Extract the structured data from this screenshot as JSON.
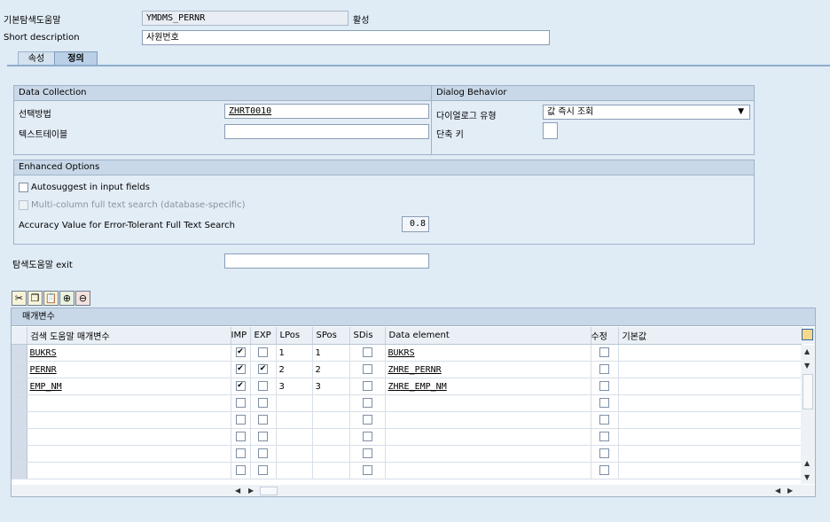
{
  "header": {
    "name_label": "기본탐색도움말",
    "name_value": "YMDMS_PERNR",
    "status": "활성",
    "short_desc_label": "Short description",
    "short_desc_value": "사원번호"
  },
  "tabs": [
    {
      "label": "속성",
      "active": false
    },
    {
      "label": "정의",
      "active": true
    }
  ],
  "data_collection": {
    "title": "Data Collection",
    "method_label": "선택방법",
    "method_value": "ZHRT0010",
    "text_table_label": "텍스트테이블",
    "text_table_value": ""
  },
  "dialog_behavior": {
    "title": "Dialog Behavior",
    "type_label": "다이얼로그 유형",
    "type_value": "값 즉시 조회",
    "hotkey_label": "단축 키",
    "hotkey_value": ""
  },
  "enhanced_options": {
    "title": "Enhanced Options",
    "autosuggest_label": "Autosuggest in input fields",
    "multicolumn_label": "Multi-column full text search (database-specific)",
    "accuracy_label": "Accuracy Value for Error-Tolerant Full Text Search",
    "accuracy_value": "0.8"
  },
  "exit": {
    "label": "탐색도움말 exit",
    "value": ""
  },
  "toolbar": {
    "icons": [
      "cut-icon",
      "copy-icon",
      "paste-icon",
      "insert-row-icon",
      "delete-row-icon"
    ]
  },
  "params": {
    "title": "매개변수",
    "columns": [
      "검색 도움말 매개변수",
      "IMP",
      "EXP",
      "LPos",
      "SPos",
      "SDis",
      "Data element",
      "수정",
      "기본값"
    ],
    "rows": [
      {
        "param": "BUKRS",
        "imp": true,
        "exp": false,
        "lpos": "1",
        "spos": "1",
        "sdis": false,
        "elem": "BUKRS",
        "mod": false,
        "def": ""
      },
      {
        "param": "PERNR",
        "imp": true,
        "exp": true,
        "lpos": "2",
        "spos": "2",
        "sdis": false,
        "elem": "ZHRE_PERNR",
        "mod": false,
        "def": ""
      },
      {
        "param": "EMP_NM",
        "imp": true,
        "exp": false,
        "lpos": "3",
        "spos": "3",
        "sdis": false,
        "elem": "ZHRE_EMP_NM",
        "mod": false,
        "def": ""
      },
      {
        "param": "",
        "imp": false,
        "exp": false,
        "lpos": "",
        "spos": "",
        "sdis": false,
        "elem": "",
        "mod": false,
        "def": ""
      },
      {
        "param": "",
        "imp": false,
        "exp": false,
        "lpos": "",
        "spos": "",
        "sdis": false,
        "elem": "",
        "mod": false,
        "def": ""
      },
      {
        "param": "",
        "imp": false,
        "exp": false,
        "lpos": "",
        "spos": "",
        "sdis": false,
        "elem": "",
        "mod": false,
        "def": ""
      },
      {
        "param": "",
        "imp": false,
        "exp": false,
        "lpos": "",
        "spos": "",
        "sdis": false,
        "elem": "",
        "mod": false,
        "def": ""
      },
      {
        "param": "",
        "imp": false,
        "exp": false,
        "lpos": "",
        "spos": "",
        "sdis": false,
        "elem": "",
        "mod": false,
        "def": ""
      }
    ]
  }
}
